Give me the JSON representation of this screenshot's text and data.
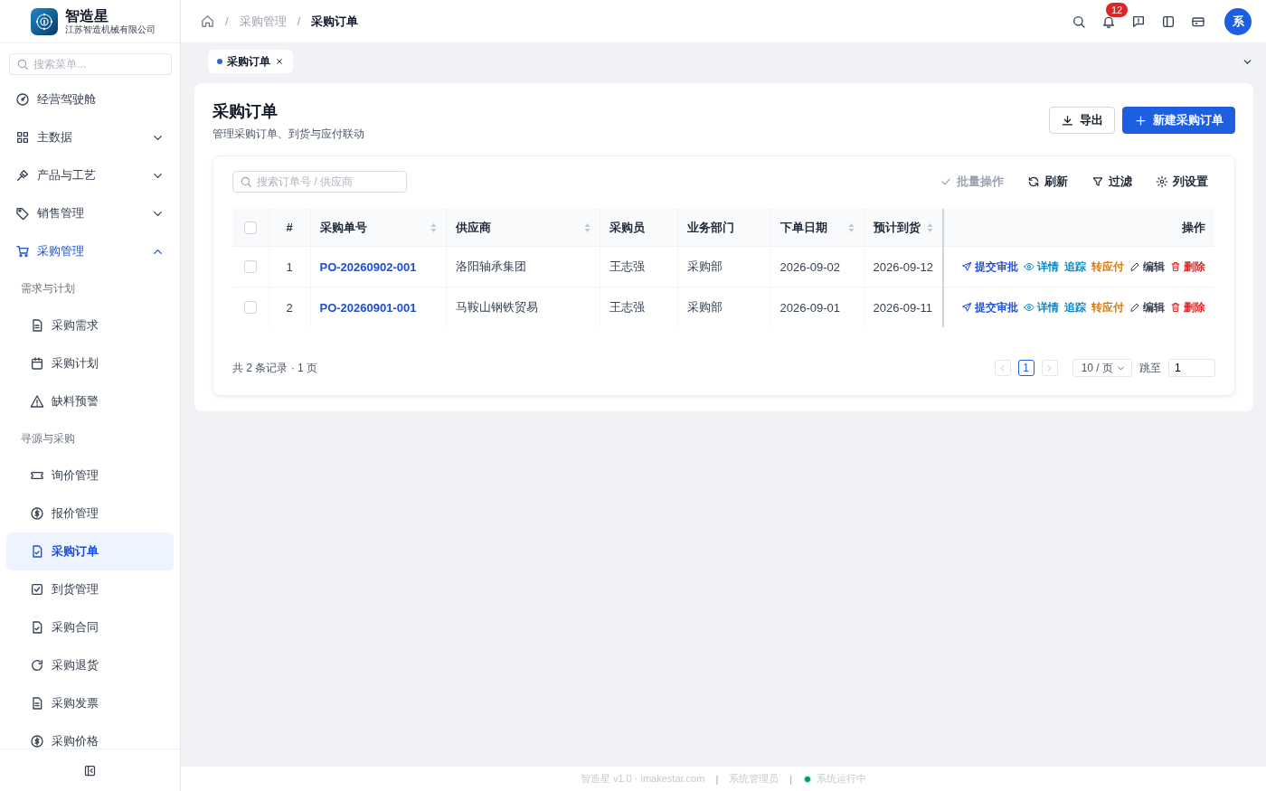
{
  "brand": {
    "name": "智造星",
    "company": "江苏智造机械有限公司"
  },
  "sidebar": {
    "search": {
      "placeholder": "搜索菜单..."
    },
    "menu": [
      {
        "label": "经营驾驶舱",
        "selected": false
      },
      {
        "label": "主数据",
        "selected": false,
        "expanded": false
      },
      {
        "label": "产品与工艺",
        "selected": false,
        "expanded": false
      },
      {
        "label": "销售管理",
        "selected": false,
        "expanded": false
      },
      {
        "label": "采购管理",
        "selected": true,
        "expanded": true,
        "children": [
          {
            "label": "需求与计划",
            "children": [
              {
                "label": "采购需求",
                "selected": false
              },
              {
                "label": "采购计划",
                "selected": false
              },
              {
                "label": "缺料预警",
                "selected": false
              }
            ]
          },
          {
            "label": "寻源与采购",
            "children": [
              {
                "label": "询价管理",
                "selected": false
              },
              {
                "label": "报价管理",
                "selected": false
              },
              {
                "label": "采购订单",
                "selected": true
              },
              {
                "label": "到货管理",
                "selected": false
              },
              {
                "label": "采购合同",
                "selected": false
              },
              {
                "label": "采购退货",
                "selected": false
              },
              {
                "label": "采购发票",
                "selected": false
              },
              {
                "label": "采购价格",
                "selected": false
              }
            ]
          }
        ]
      }
    ]
  },
  "header": {
    "breadcrumb_separator": "/",
    "breadcrumb": [
      "采购管理",
      "采购订单"
    ],
    "notification_count": "12",
    "avatar": "系"
  },
  "tabs": [
    {
      "label": "采购订单",
      "selected": true
    }
  ],
  "page": {
    "title": "采购订单",
    "subtitle": "管理采购订单、到货与应付联动",
    "buttons": [
      {
        "label": "导出",
        "kind": "secondary"
      },
      {
        "label": "新建采购订单",
        "kind": "primary"
      }
    ],
    "search": {
      "placeholder": "搜索订单号 / 供应商"
    },
    "toolbar": [
      {
        "label": "批量操作",
        "kind": "batch",
        "disabled": true
      },
      {
        "label": "刷新",
        "kind": "refresh",
        "disabled": false
      },
      {
        "label": "过滤",
        "kind": "filter",
        "disabled": false
      },
      {
        "label": "列设置",
        "kind": "columns",
        "disabled": false
      }
    ],
    "table": {
      "all_checked": false,
      "columns": [
        {
          "label": "#",
          "sortable": false
        },
        {
          "label": "采购单号",
          "sortable": true
        },
        {
          "label": "供应商",
          "sortable": true
        },
        {
          "label": "采购员",
          "sortable": false
        },
        {
          "label": "业务部门",
          "sortable": false
        },
        {
          "label": "下单日期",
          "sortable": true
        },
        {
          "label": "预计到货",
          "sortable": true
        },
        {
          "label": "操作",
          "sortable": false
        }
      ],
      "rows": [
        {
          "checked": false,
          "index": "1",
          "order_no": "PO-20260902-001",
          "supplier": "洛阳轴承集团",
          "buyer": "王志强",
          "department": "采购部",
          "order_date": "2026-09-02",
          "eta": "2026-09-12",
          "actions": [
            {
              "label": "提交审批",
              "kind": "submit"
            },
            {
              "label": "详情",
              "kind": "detail"
            },
            {
              "label": "追踪",
              "kind": "track"
            },
            {
              "label": "转应付",
              "kind": "payable"
            },
            {
              "label": "编辑",
              "kind": "edit"
            },
            {
              "label": "删除",
              "kind": "delete"
            }
          ]
        },
        {
          "checked": false,
          "index": "2",
          "order_no": "PO-20260901-001",
          "supplier": "马鞍山钢铁贸易",
          "buyer": "王志强",
          "department": "采购部",
          "order_date": "2026-09-01",
          "eta": "2026-09-11",
          "actions": [
            {
              "label": "提交审批",
              "kind": "submit"
            },
            {
              "label": "详情",
              "kind": "detail"
            },
            {
              "label": "追踪",
              "kind": "track"
            },
            {
              "label": "转应付",
              "kind": "payable"
            },
            {
              "label": "编辑",
              "kind": "edit"
            },
            {
              "label": "删除",
              "kind": "delete"
            }
          ]
        }
      ]
    },
    "pagination": {
      "summary": "共 2 条记录 · 1 页",
      "pages": [
        {
          "label": "1",
          "selected": true
        }
      ],
      "page_size": "10 / 页",
      "jump_label": "跳至",
      "jump_value": "1"
    }
  },
  "footer": {
    "separator": "|",
    "items": [
      "智造星 v1.0 · imakestar.com",
      "系统管理员"
    ],
    "status": "系统运行中"
  }
}
